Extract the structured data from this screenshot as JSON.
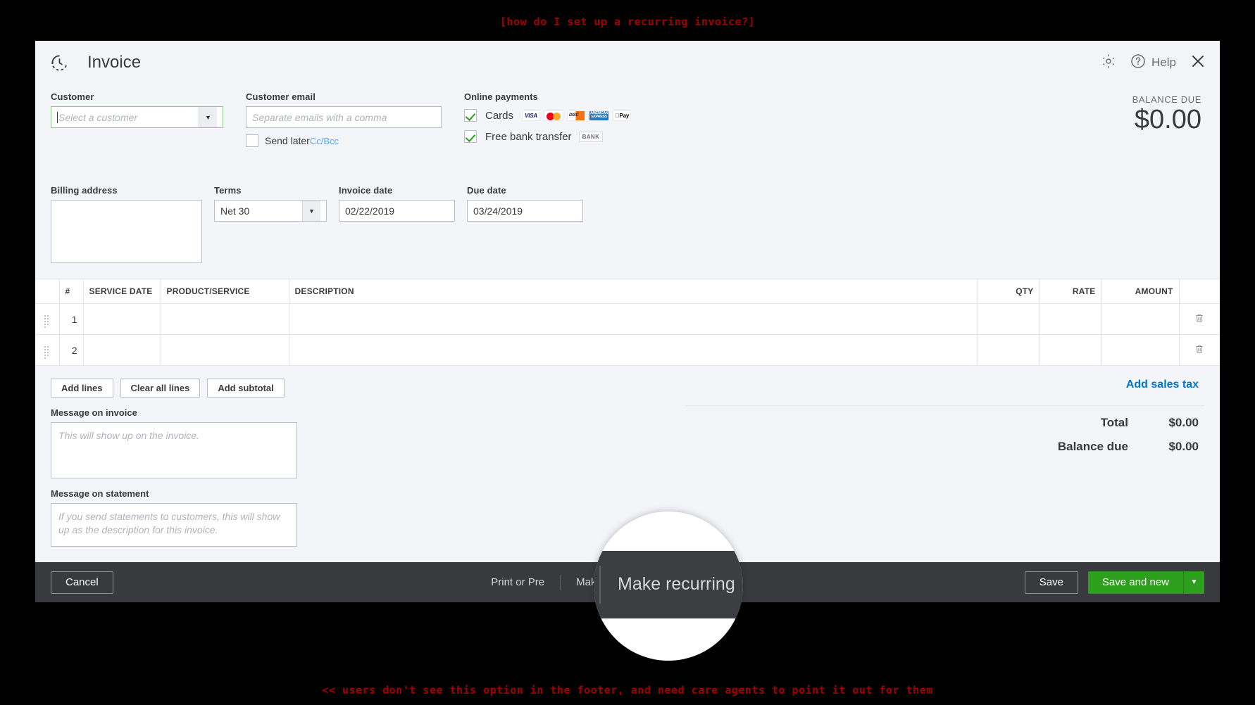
{
  "annotations": {
    "top": "[how do I set up a recurring invoice?]",
    "bottom": "<< users don't see this option in the footer, and need care agents to point it out for them"
  },
  "header": {
    "title": "Invoice",
    "recurring_icon": "recurring-clock-icon",
    "gear_icon": "gear-icon",
    "help_icon": "help-circle-icon",
    "help_label": "Help",
    "close_icon": "close-x-icon"
  },
  "customer": {
    "label": "Customer",
    "placeholder": "Select a customer",
    "value": ""
  },
  "customer_email": {
    "label": "Customer email",
    "placeholder": "Separate emails with a comma",
    "value": "",
    "send_later_label": "Send later",
    "send_later_checked": false,
    "ccbcc_label": "Cc/Bcc"
  },
  "online_payments": {
    "title": "Online payments",
    "cards": {
      "label": "Cards",
      "checked": true,
      "logos": [
        "VISA",
        "Mastercard",
        "DISCOVER",
        "AMERICAN EXPRESS",
        "Apple Pay"
      ]
    },
    "bank": {
      "label": "Free bank transfer",
      "checked": true,
      "badge": "BANK"
    }
  },
  "balance_due": {
    "label": "BALANCE DUE",
    "amount": "$0.00"
  },
  "billing_address": {
    "label": "Billing address",
    "value": ""
  },
  "terms": {
    "label": "Terms",
    "value": "Net 30"
  },
  "invoice_date": {
    "label": "Invoice date",
    "value": "02/22/2019"
  },
  "due_date": {
    "label": "Due date",
    "value": "03/24/2019"
  },
  "line_table": {
    "headers": {
      "num": "#",
      "service_date": "SERVICE DATE",
      "product": "PRODUCT/SERVICE",
      "description": "DESCRIPTION",
      "qty": "QTY",
      "rate": "RATE",
      "amount": "AMOUNT"
    },
    "rows": [
      {
        "num": "1",
        "service_date": "",
        "product": "",
        "description": "",
        "qty": "",
        "rate": "",
        "amount": ""
      },
      {
        "num": "2",
        "service_date": "",
        "product": "",
        "description": "",
        "qty": "",
        "rate": "",
        "amount": ""
      }
    ]
  },
  "line_buttons": {
    "add_lines": "Add lines",
    "clear_all_lines": "Clear all lines",
    "add_subtotal": "Add subtotal"
  },
  "messages": {
    "invoice_label": "Message on invoice",
    "invoice_placeholder": "This will show up on the invoice.",
    "invoice_value": "",
    "statement_label": "Message on statement",
    "statement_placeholder": "If you send statements to customers, this will show up as the description for this invoice.",
    "statement_value": ""
  },
  "totals": {
    "add_sales_tax": "Add sales tax",
    "total_label": "Total",
    "total_value": "$0.00",
    "balance_due_label": "Balance due",
    "balance_due_value": "$0.00"
  },
  "footer": {
    "cancel": "Cancel",
    "print_or_preview": "Print or Pre",
    "make_recurring": "Make recurring",
    "save": "Save",
    "save_and_new": "Save and new",
    "save_dropdown_icon": "chevron-down-icon"
  },
  "colors": {
    "accent_green": "#2ca01c",
    "link_blue": "#0077c5",
    "footer_dark": "#393a3d",
    "annotation_red": "#a00000"
  }
}
